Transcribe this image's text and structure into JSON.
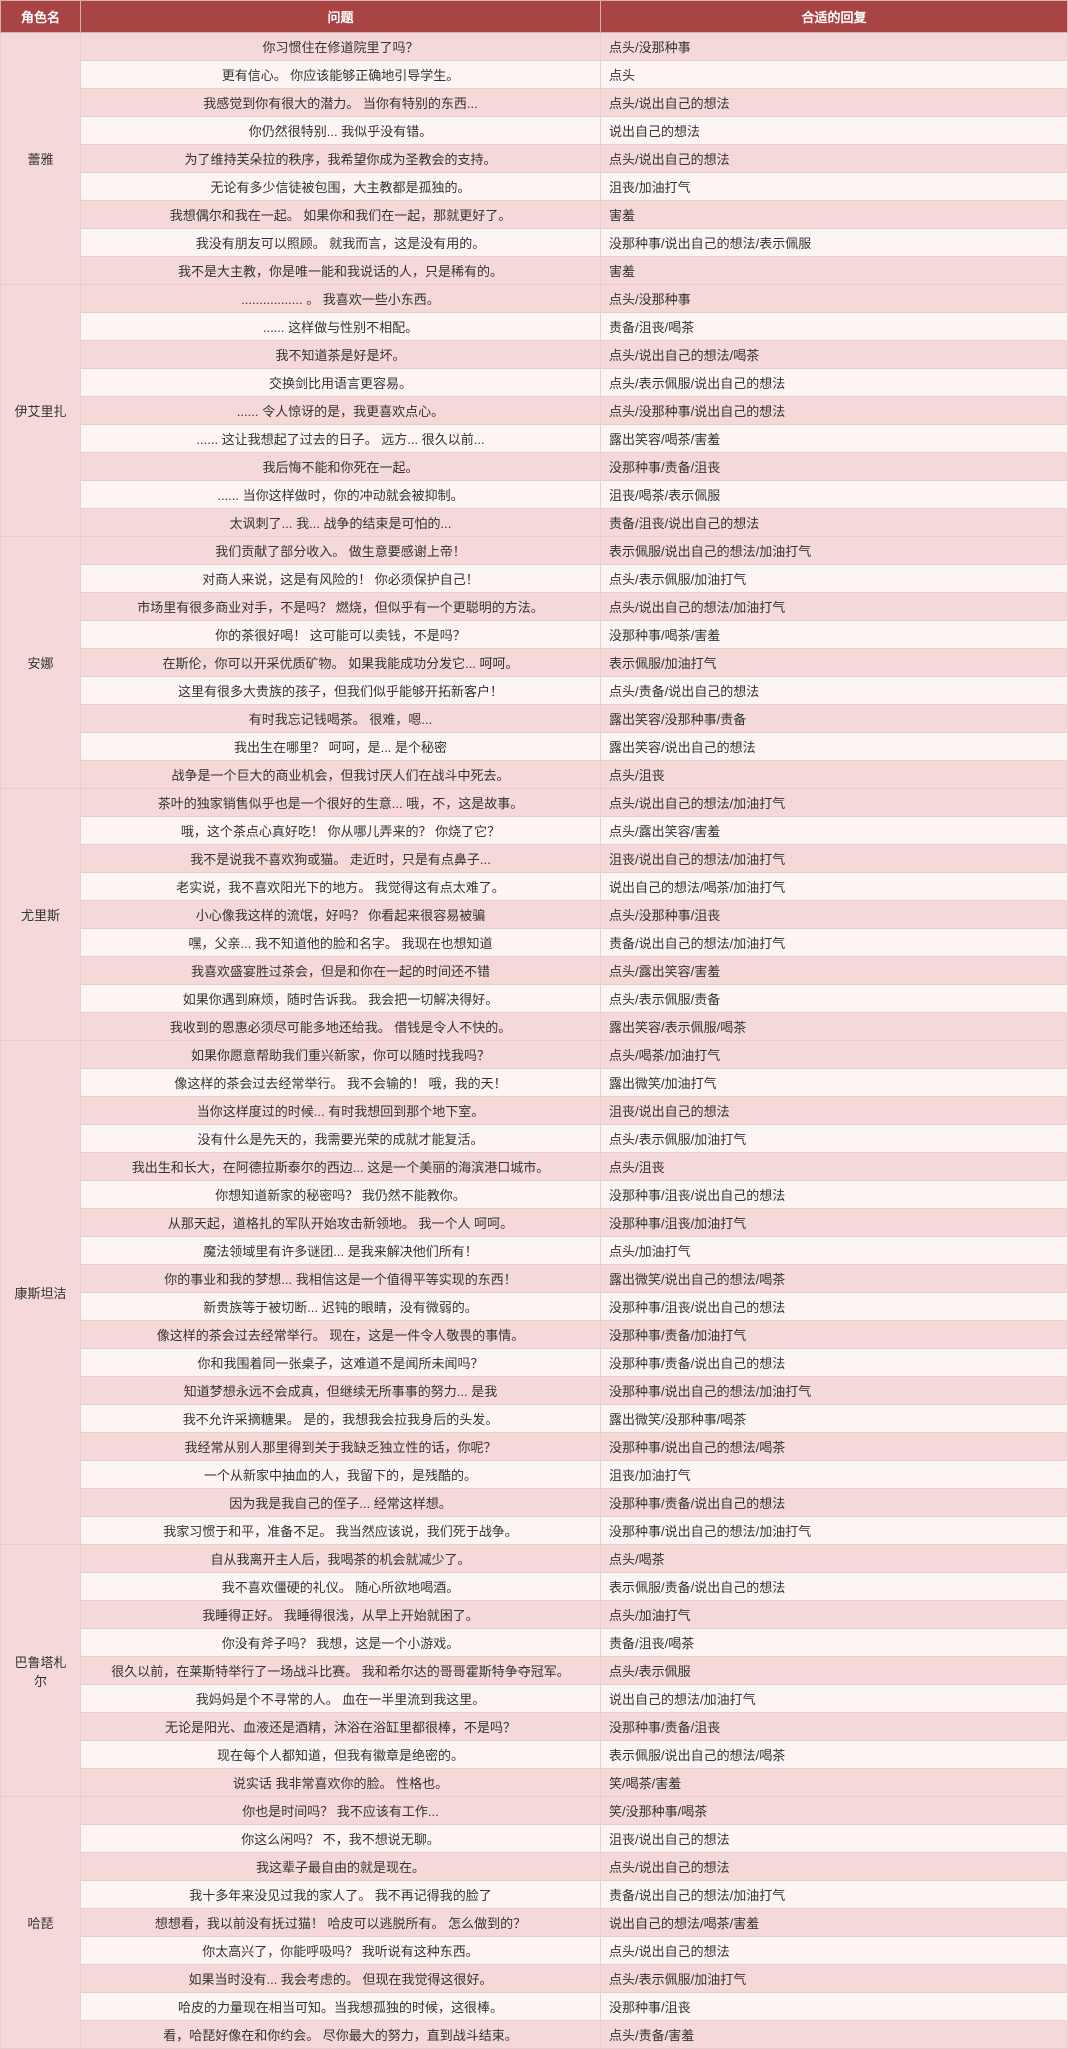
{
  "headers": {
    "char": "角色名",
    "q": "问题",
    "a": "合适的回复"
  },
  "groups": [
    {
      "char": "蕾雅",
      "rows": [
        {
          "q": "你习惯住在修道院里了吗？",
          "a": "点头/没那种事"
        },
        {
          "q": "更有信心。 你应该能够正确地引导学生。",
          "a": "点头"
        },
        {
          "q": "我感觉到你有很大的潜力。 当你有特别的东西...",
          "a": "点头/说出自己的想法"
        },
        {
          "q": "你仍然很特别... 我似乎没有错。",
          "a": "说出自己的想法"
        },
        {
          "q": "为了维持芙朵拉的秩序，我希望你成为圣教会的支持。",
          "a": "点头/说出自己的想法"
        },
        {
          "q": "无论有多少信徒被包围，大主教都是孤独的。",
          "a": "沮丧/加油打气"
        },
        {
          "q": "我想偶尔和我在一起。 如果你和我们在一起，那就更好了。",
          "a": "害羞"
        },
        {
          "q": "我没有朋友可以照顾。 就我而言，这是没有用的。",
          "a": "没那种事/说出自己的想法/表示佩服"
        },
        {
          "q": "我不是大主教，你是唯一能和我说话的人，只是稀有的。",
          "a": "害羞"
        }
      ]
    },
    {
      "char": "伊艾里扎",
      "rows": [
        {
          "q": "................. 。 我喜欢一些小东西。",
          "a": "点头/没那种事"
        },
        {
          "q": "...... 这样做与性别不相配。",
          "a": "责备/沮丧/喝茶"
        },
        {
          "q": "我不知道茶是好是坏。",
          "a": "点头/说出自己的想法/喝茶"
        },
        {
          "q": "交换剑比用语言更容易。",
          "a": "点头/表示佩服/说出自己的想法"
        },
        {
          "q": "...... 令人惊讶的是，我更喜欢点心。",
          "a": "点头/没那种事/说出自己的想法"
        },
        {
          "q": "...... 这让我想起了过去的日子。 远方... 很久以前...",
          "a": "露出笑容/喝茶/害羞"
        },
        {
          "q": "我后悔不能和你死在一起。",
          "a": "没那种事/责备/沮丧"
        },
        {
          "q": "...... 当你这样做时，你的冲动就会被抑制。",
          "a": "沮丧/喝茶/表示佩服"
        },
        {
          "q": "太讽刺了... 我... 战争的结束是可怕的...",
          "a": "责备/沮丧/说出自己的想法"
        }
      ]
    },
    {
      "char": "安娜",
      "rows": [
        {
          "q": "我们贡献了部分收入。 做生意要感谢上帝！",
          "a": "表示佩服/说出自己的想法/加油打气"
        },
        {
          "q": "对商人来说，这是有风险的！ 你必须保护自己！",
          "a": "点头/表示佩服/加油打气"
        },
        {
          "q": "市场里有很多商业对手，不是吗？ 燃烧，但似乎有一个更聪明的方法。",
          "a": "点头/说出自己的想法/加油打气"
        },
        {
          "q": "你的茶很好喝！ 这可能可以卖钱，不是吗？",
          "a": "没那种事/喝茶/害羞"
        },
        {
          "q": "在斯伦，你可以开采优质矿物。 如果我能成功分发它... 呵呵。",
          "a": "表示佩服/加油打气"
        },
        {
          "q": "这里有很多大贵族的孩子，但我们似乎能够开拓新客户！",
          "a": "点头/责备/说出自己的想法"
        },
        {
          "q": "有时我忘记钱喝茶。 很难，嗯...",
          "a": "露出笑容/没那种事/责备"
        },
        {
          "q": "我出生在哪里？ 呵呵，是... 是个秘密",
          "a": "露出笑容/说出自己的想法"
        },
        {
          "q": "战争是一个巨大的商业机会，但我讨厌人们在战斗中死去。",
          "a": "点头/沮丧"
        }
      ]
    },
    {
      "char": "尤里斯",
      "rows": [
        {
          "q": "茶叶的独家销售似乎也是一个很好的生意... 哦，不，这是故事。",
          "a": "点头/说出自己的想法/加油打气"
        },
        {
          "q": "哦，这个茶点心真好吃！ 你从哪儿弄来的？ 你烧了它？",
          "a": "点头/露出笑容/害羞"
        },
        {
          "q": "我不是说我不喜欢狗或猫。 走近时，只是有点鼻子...",
          "a": "沮丧/说出自己的想法/加油打气"
        },
        {
          "q": "老实说，我不喜欢阳光下的地方。 我觉得这有点太难了。",
          "a": "说出自己的想法/喝茶/加油打气"
        },
        {
          "q": "小心像我这样的流氓，好吗？ 你看起来很容易被骗",
          "a": "点头/没那种事/沮丧"
        },
        {
          "q": "嘿，父亲... 我不知道他的脸和名字。 我现在也想知道",
          "a": "责备/说出自己的想法/加油打气"
        },
        {
          "q": "我喜欢盛宴胜过茶会，但是和你在一起的时间还不错",
          "a": "点头/露出笑容/害羞"
        },
        {
          "q": "如果你遇到麻烦，随时告诉我。 我会把一切解决得好。",
          "a": "点头/表示佩服/责备"
        },
        {
          "q": "我收到的恩惠必须尽可能多地还给我。 借钱是令人不快的。",
          "a": "露出笑容/表示佩服/喝茶"
        }
      ]
    },
    {
      "char": "康斯坦洁",
      "rows": [
        {
          "q": "如果你愿意帮助我们重兴新家，你可以随时找我吗？",
          "a": "点头/喝茶/加油打气"
        },
        {
          "q": "像这样的茶会过去经常举行。 我不会输的！ 哦，我的天！",
          "a": "露出微笑/加油打气"
        },
        {
          "q": "当你这样度过的时候... 有时我想回到那个地下室。",
          "a": "沮丧/说出自己的想法"
        },
        {
          "q": "没有什么是先天的，我需要光荣的成就才能复活。",
          "a": "点头/表示佩服/加油打气"
        },
        {
          "q": "我出生和长大，在阿德拉斯泰尔的西边... 这是一个美丽的海滨港口城市。",
          "a": "点头/沮丧"
        },
        {
          "q": "你想知道新家的秘密吗？ 我仍然不能教你。",
          "a": "没那种事/沮丧/说出自己的想法"
        },
        {
          "q": "从那天起，道格扎的军队开始攻击新领地。 我一个人 呵呵。",
          "a": "没那种事/沮丧/加油打气"
        },
        {
          "q": "魔法领域里有许多谜团... 是我来解决他们所有！",
          "a": "点头/加油打气"
        },
        {
          "q": "你的事业和我的梦想... 我相信这是一个值得平等实现的东西！",
          "a": "露出微笑/说出自己的想法/喝茶"
        },
        {
          "q": "新贵族等于被切断... 迟钝的眼睛，没有微弱的。",
          "a": "没那种事/沮丧/说出自己的想法"
        },
        {
          "q": "像这样的茶会过去经常举行。 现在，这是一件令人敬畏的事情。",
          "a": "没那种事/责备/加油打气"
        },
        {
          "q": "你和我围着同一张桌子，这难道不是闻所未闻吗？",
          "a": "没那种事/责备/说出自己的想法"
        },
        {
          "q": "知道梦想永远不会成真，但继续无所事事的努力... 是我",
          "a": "没那种事/说出自己的想法/加油打气"
        },
        {
          "q": "我不允许采摘糖果。 是的，我想我会拉我身后的头发。",
          "a": "露出微笑/没那种事/喝茶"
        },
        {
          "q": "我经常从别人那里得到关于我缺乏独立性的话，你呢？",
          "a": "没那种事/说出自己的想法/喝茶"
        },
        {
          "q": "一个从新家中抽血的人，我留下的，是残酷的。",
          "a": "沮丧/加油打气"
        },
        {
          "q": "因为我是我自己的侄子... 经常这样想。",
          "a": "没那种事/责备/说出自己的想法"
        },
        {
          "q": "我家习惯于和平，准备不足。 我当然应该说，我们死于战争。",
          "a": "没那种事/说出自己的想法/加油打气"
        }
      ]
    },
    {
      "char": "巴鲁塔札尔",
      "rows": [
        {
          "q": "自从我离开主人后，我喝茶的机会就减少了。",
          "a": "点头/喝茶"
        },
        {
          "q": "我不喜欢僵硬的礼仪。 随心所欲地喝酒。",
          "a": "表示佩服/责备/说出自己的想法"
        },
        {
          "q": "我睡得正好。 我睡得很浅，从早上开始就困了。",
          "a": "点头/加油打气"
        },
        {
          "q": "你没有斧子吗？ 我想，这是一个小游戏。",
          "a": "责备/沮丧/喝茶"
        },
        {
          "q": "很久以前，在莱斯特举行了一场战斗比赛。 我和希尔达的哥哥霍斯特争夺冠军。",
          "a": "点头/表示佩服"
        },
        {
          "q": "我妈妈是个不寻常的人。 血在一半里流到我这里。",
          "a": "说出自己的想法/加油打气"
        },
        {
          "q": "无论是阳光、血液还是酒精，沐浴在浴缸里都很棒，不是吗？",
          "a": "没那种事/责备/沮丧"
        },
        {
          "q": "现在每个人都知道，但我有徽章是绝密的。",
          "a": "表示佩服/说出自己的想法/喝茶"
        },
        {
          "q": "说实话 我非常喜欢你的脸。 性格也。",
          "a": "笑/喝茶/害羞"
        }
      ]
    },
    {
      "char": "哈琵",
      "rows": [
        {
          "q": "你也是时间吗？ 我不应该有工作...",
          "a": "笑/没那种事/喝茶"
        },
        {
          "q": "你这么闲吗？ 不，我不想说无聊。",
          "a": "沮丧/说出自己的想法"
        },
        {
          "q": "我这辈子最自由的就是现在。",
          "a": "点头/说出自己的想法"
        },
        {
          "q": "我十多年来没见过我的家人了。 我不再记得我的脸了",
          "a": "责备/说出自己的想法/加油打气"
        },
        {
          "q": "想想看，我以前没有抚过猫！ 哈皮可以逃脱所有。 怎么做到的？",
          "a": "说出自己的想法/喝茶/害羞"
        },
        {
          "q": "你太高兴了，你能呼吸吗？ 我听说有这种东西。",
          "a": "点头/说出自己的想法"
        },
        {
          "q": "如果当时没有... 我会考虑的。 但现在我觉得这很好。",
          "a": "点头/表示佩服/加油打气"
        },
        {
          "q": "哈皮的力量现在相当可知。当我想孤独的时候，这很棒。",
          "a": "没那种事/沮丧"
        },
        {
          "q": "看，哈琵好像在和你约会。 尽你最大的努力，直到战斗结束。",
          "a": "点头/责备/害羞"
        }
      ]
    }
  ]
}
